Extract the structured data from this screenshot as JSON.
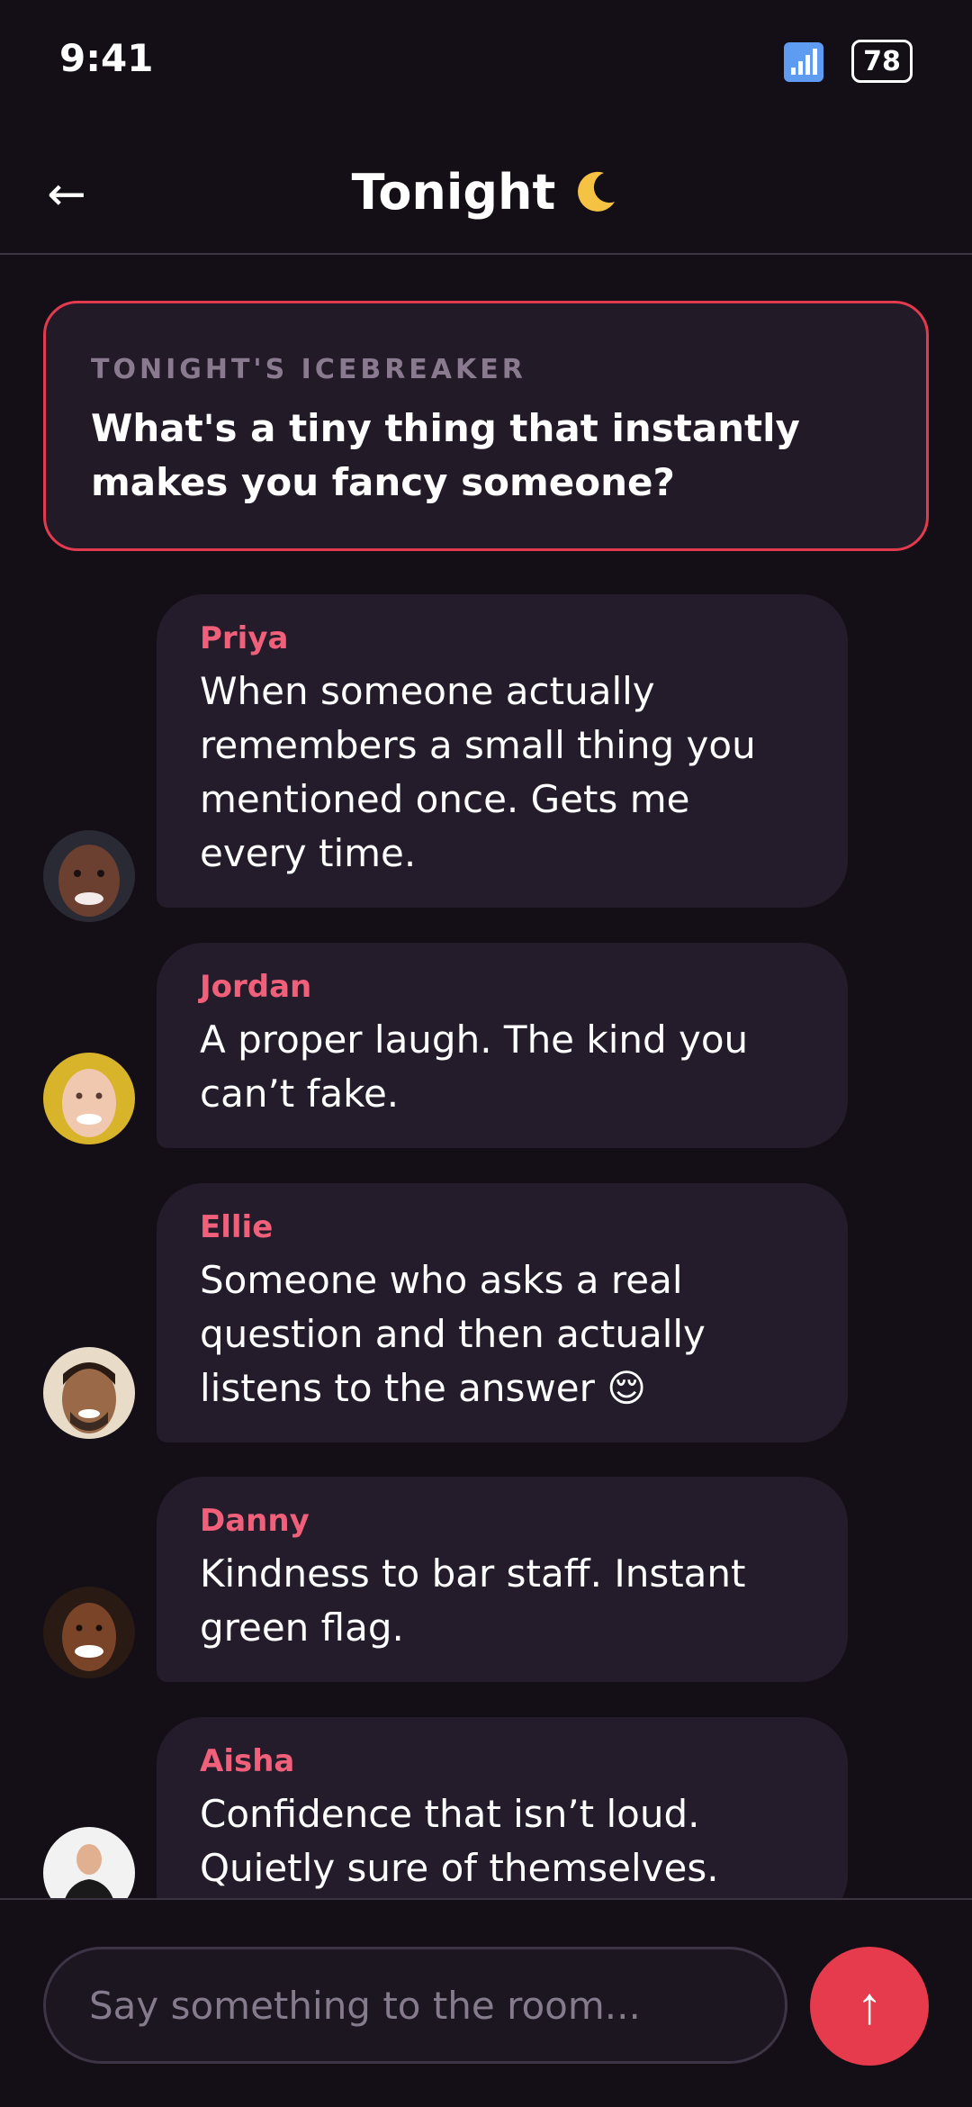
{
  "status_bar": {
    "time": "9:41",
    "signal_icon": "signal-bars-icon",
    "battery_level": "78"
  },
  "header": {
    "back_icon": "←",
    "title": "Tonight"
  },
  "icebreaker": {
    "label": "TONIGHT'S ICEBREAKER",
    "question": "What's a tiny thing that instantly makes you fancy someone?"
  },
  "messages": [
    {
      "sender": "Priya",
      "text": "When someone actually remembers a small thing you mentioned once. Gets me every time."
    },
    {
      "sender": "Jordan",
      "text": "A proper laugh. The kind you can’t fake."
    },
    {
      "sender": "Ellie",
      "text": "Someone who asks a real question and then actually listens to the answer 😌"
    },
    {
      "sender": "Danny",
      "text": "Kindness to bar staff. Instant green flag."
    },
    {
      "sender": "Aisha",
      "text": "Confidence that isn’t loud. Quietly sure of themselves."
    }
  ],
  "composer": {
    "placeholder": "Say something to the room...",
    "send_icon": "↑"
  },
  "colors": {
    "background": "#140f17",
    "bubble": "#241c2a",
    "accent": "#e63a4d",
    "sender_name": "#f0607a"
  }
}
